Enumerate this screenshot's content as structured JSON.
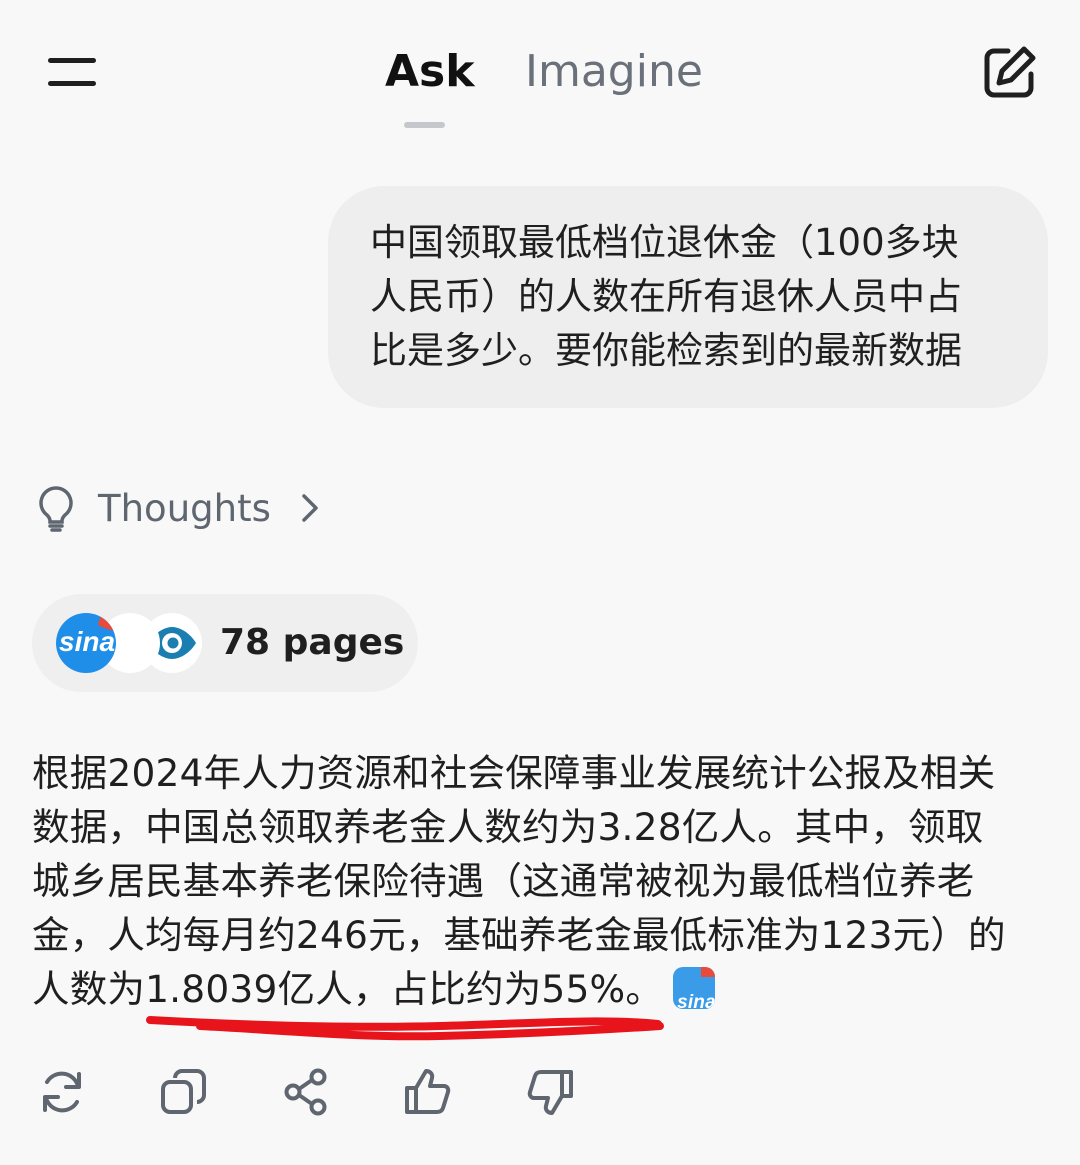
{
  "header": {
    "menu_icon": "hamburger-menu-icon",
    "tabs": [
      {
        "label": "Ask",
        "active": true
      },
      {
        "label": "Imagine",
        "active": false
      }
    ],
    "new_chat_icon": "edit-square-icon"
  },
  "user_message": {
    "lines": [
      "中国领取最低档位退休金（100多块",
      "人民币）的人数在所有退休人员中占",
      "比是多少。要你能检索到的最新数据"
    ]
  },
  "thoughts": {
    "label": "Thoughts",
    "icon": "lightbulb-icon",
    "chevron": "chevron-right-icon"
  },
  "sources": {
    "label": "78 pages",
    "icons": [
      "sina-logo-icon",
      "blank-source-icon",
      "eye-logo-icon"
    ],
    "sina_text": "sina"
  },
  "answer": {
    "lines": [
      "根据2024年人力资源和社会保障事业发展统计公报及相关",
      "数据，中国总领取养老金人数约为3.28亿人。其中，领取",
      "城乡居民基本养老保险待遇（这通常被视为最低档位养老",
      "金，人均每月约246元，基础养老金最低标准为123元）的",
      "人数为1.8039亿人，占比约为55%。"
    ],
    "citation_icon": "sina-citation-icon",
    "citation_text": "sina"
  },
  "actions": [
    {
      "name": "regenerate",
      "icon": "refresh-icon"
    },
    {
      "name": "copy",
      "icon": "copy-icon"
    },
    {
      "name": "share",
      "icon": "share-icon"
    },
    {
      "name": "like",
      "icon": "thumbs-up-icon"
    },
    {
      "name": "dislike",
      "icon": "thumbs-down-icon"
    }
  ],
  "colors": {
    "background": "#f8f8f8",
    "bubble": "#eeeeee",
    "muted_text": "#5f6670",
    "annotation": "#e8141c"
  }
}
